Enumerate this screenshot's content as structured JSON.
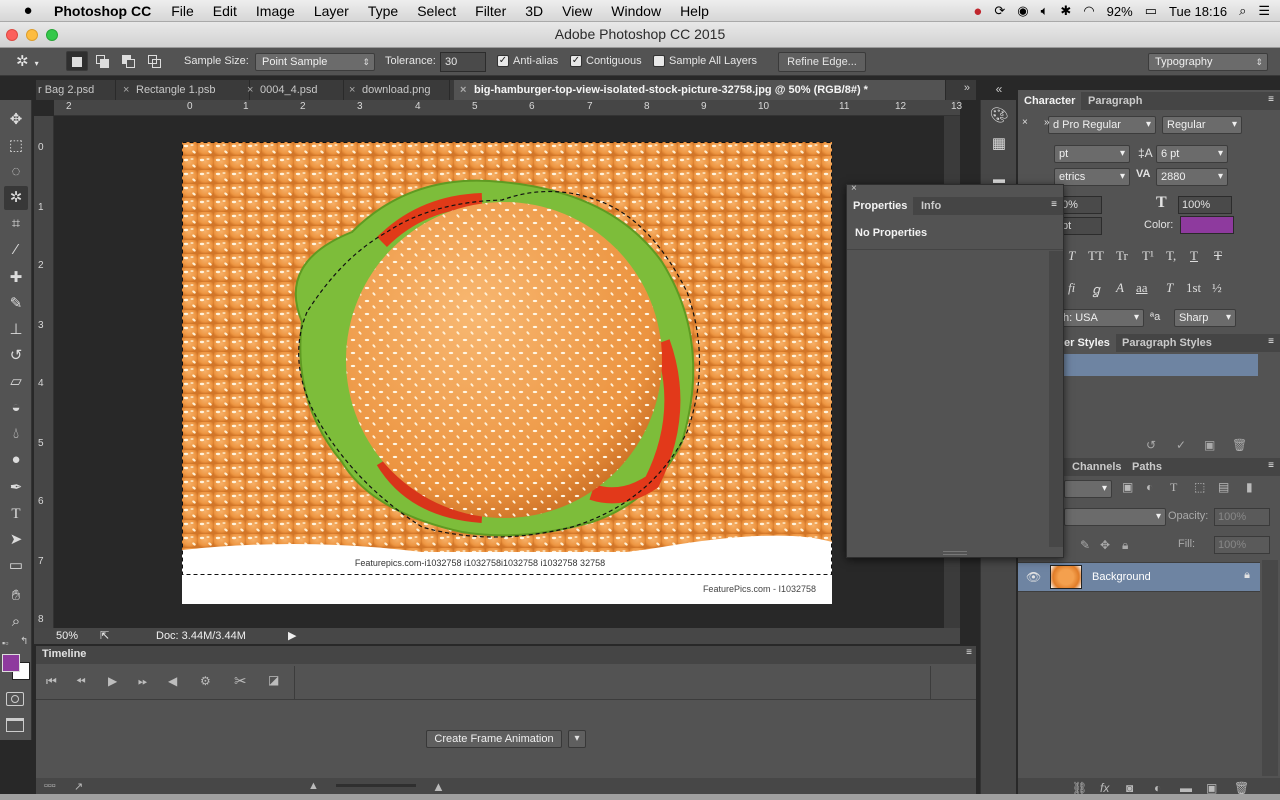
{
  "menubar": {
    "apple": "",
    "app_name": "Photoshop CC",
    "menus": [
      "File",
      "Edit",
      "Image",
      "Layer",
      "Type",
      "Select",
      "Filter",
      "3D",
      "View",
      "Window",
      "Help"
    ],
    "battery": "92%",
    "clock": "Tue 18:16"
  },
  "window": {
    "title": "Adobe Photoshop CC 2015"
  },
  "options": {
    "sample_size_label": "Sample Size:",
    "sample_size_value": "Point Sample",
    "tolerance_label": "Tolerance:",
    "tolerance_value": "30",
    "anti_alias": "Anti-alias",
    "contiguous": "Contiguous",
    "sample_all_layers": "Sample All Layers",
    "refine_edge": "Refine Edge...",
    "workspace": "Typography"
  },
  "doc_tabs": [
    {
      "label": "r Bag 2.psd"
    },
    {
      "label": "Rectangle 1.psb"
    },
    {
      "label": "0004_4.psd"
    },
    {
      "label": "download.png"
    },
    {
      "label": "big-hamburger-top-view-isolated-stock-picture-32758.jpg @ 50% (RGB/8#) *"
    }
  ],
  "ruler": {
    "top": [
      "2",
      "0",
      "1",
      "2",
      "3",
      "4",
      "5",
      "6",
      "7",
      "8",
      "9",
      "10",
      "11",
      "12",
      "13"
    ],
    "left": [
      "0",
      "1",
      "2",
      "3",
      "4",
      "5",
      "6",
      "7",
      "8"
    ]
  },
  "canvas": {
    "watermark_small": "FeaturePics.com - I1032758",
    "selection_text": "Featurepics.com-i1032758 i1032758i1032758 i1032758 32758"
  },
  "status": {
    "zoom": "50%",
    "doc": "Doc: 3.44M/3.44M"
  },
  "timeline": {
    "title": "Timeline",
    "create_button": "Create Frame Animation"
  },
  "character": {
    "tab_active": "Character",
    "tab_other": "Paragraph",
    "font_family": "d Pro Regular",
    "font_style": "Regular",
    "font_size": "pt",
    "leading": "6 pt",
    "kerning": "etrics",
    "tracking": "2880",
    "scale_v": "0%",
    "scale_h": "100%",
    "baseline": "pt",
    "color_label": "Color:",
    "color_value": "#8e3a9e",
    "typo_buttons": [
      "T",
      "TT",
      "Tr",
      "T¹",
      "T,",
      "T",
      "T"
    ],
    "ot_buttons": [
      "fi",
      "ꬶ",
      "st",
      "A",
      "aa",
      "T",
      "1st",
      "½"
    ],
    "language": "h: USA",
    "aa_icon": "ªa",
    "aa_value": "Sharp"
  },
  "styles": {
    "tab_active": "er Styles",
    "tab_other": "Paragraph Styles"
  },
  "properties": {
    "tab_active": "Properties",
    "tab_other": "Info",
    "body": "No Properties"
  },
  "layers": {
    "tabs": [
      "Channels",
      "Paths"
    ],
    "opacity_label": "Opacity:",
    "opacity_value": "100%",
    "fill_label": "Fill:",
    "fill_value": "100%",
    "layer_name": "Background"
  },
  "colors": {
    "foreground": "#8e3a9e",
    "background": "#ffffff",
    "accent": "#6e84a2"
  }
}
